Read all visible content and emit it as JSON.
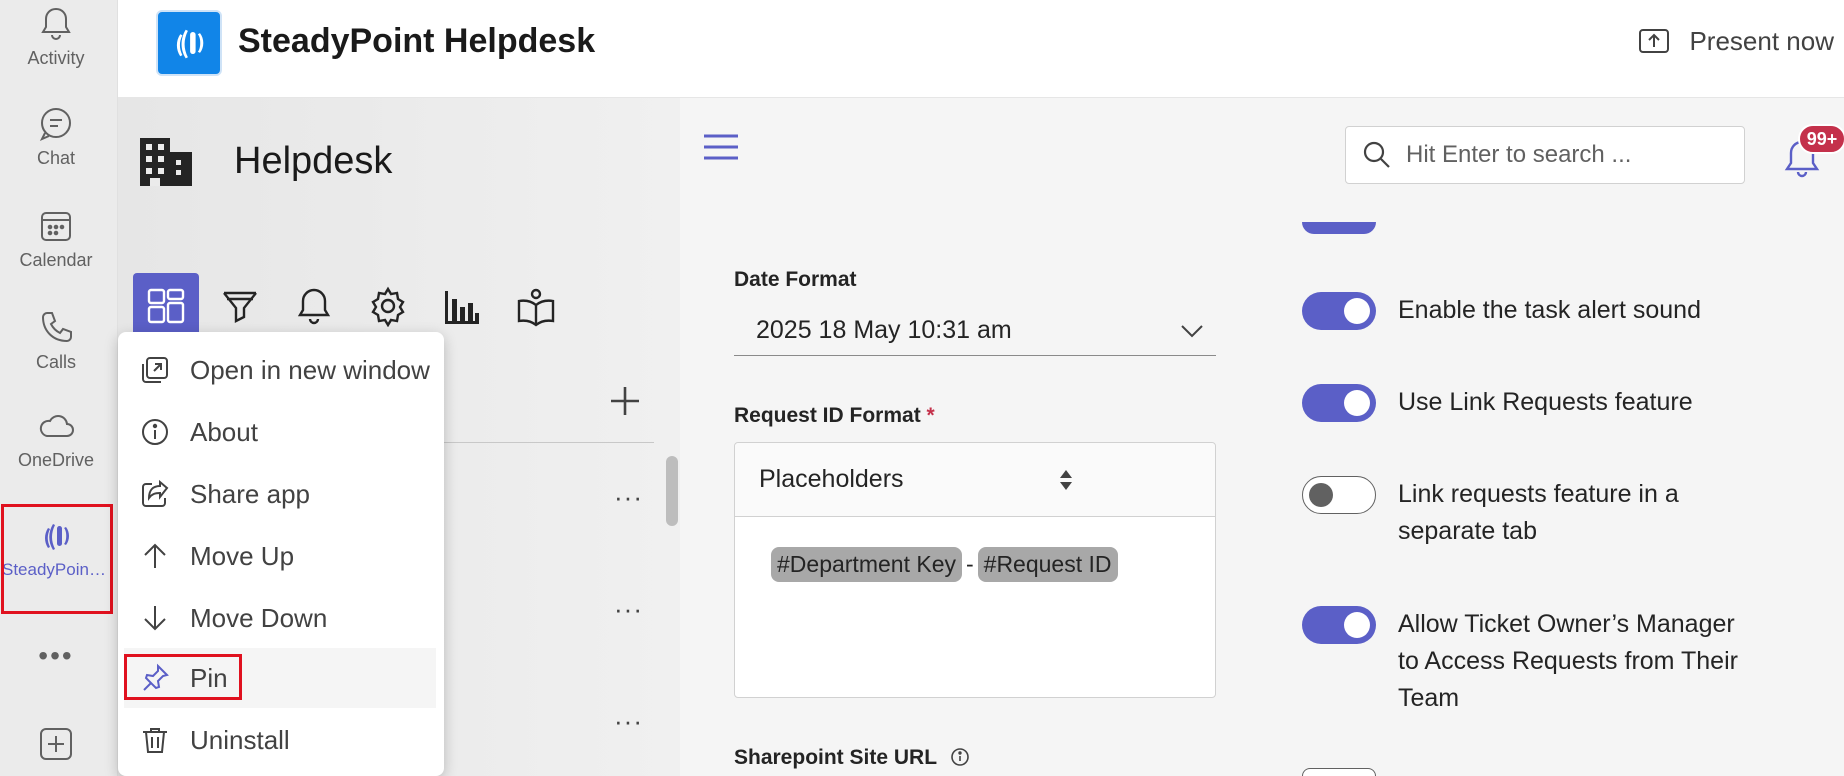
{
  "rail": {
    "items": [
      {
        "label": "Activity",
        "icon": "bell-icon"
      },
      {
        "label": "Chat",
        "icon": "chat-icon"
      },
      {
        "label": "Calendar",
        "icon": "calendar-icon"
      },
      {
        "label": "Calls",
        "icon": "phone-icon"
      },
      {
        "label": "OneDrive",
        "icon": "cloud-icon"
      },
      {
        "label": "SteadyPoint…",
        "icon": "steadypoint-logo-icon"
      }
    ],
    "more": "•••"
  },
  "header": {
    "app_title": "SteadyPoint Helpdesk",
    "present_label": "Present now"
  },
  "helpdesk": {
    "title": "Helpdesk",
    "row_menu": "···"
  },
  "context_menu": {
    "items": [
      {
        "label": "Open in new window",
        "icon": "open-window-icon"
      },
      {
        "label": "About",
        "icon": "info-icon"
      },
      {
        "label": "Share app",
        "icon": "share-icon"
      },
      {
        "label": "Move Up",
        "icon": "arrow-up-icon"
      },
      {
        "label": "Move Down",
        "icon": "arrow-down-icon"
      },
      {
        "label": "Pin",
        "icon": "pin-icon"
      },
      {
        "label": "Uninstall",
        "icon": "trash-icon"
      }
    ]
  },
  "main": {
    "search_placeholder": "Hit Enter to search ...",
    "notification_badge": "99+",
    "date_format": {
      "label": "Date Format",
      "value": "2025 18 May 10:31 am"
    },
    "request_id_format": {
      "label": "Request ID Format",
      "required_mark": "*",
      "placeholders_label": "Placeholders",
      "chip1": "#Department Key",
      "separator": "-",
      "chip2": "#Request ID"
    },
    "sharepoint_label": "Sharepoint Site URL",
    "toggles": [
      {
        "label": "Enable the task alert sound",
        "on": true
      },
      {
        "label": "Use Link Requests feature",
        "on": true
      },
      {
        "label": "Link requests feature in a separate tab",
        "on": false
      },
      {
        "label": "Allow Ticket Owner’s Manager to Access Requests from Their Team",
        "on": true
      }
    ]
  },
  "colors": {
    "accent": "#5b5fc7",
    "highlight": "#e0111f",
    "badge": "#c4314b",
    "logo_bg": "#1185e8"
  }
}
